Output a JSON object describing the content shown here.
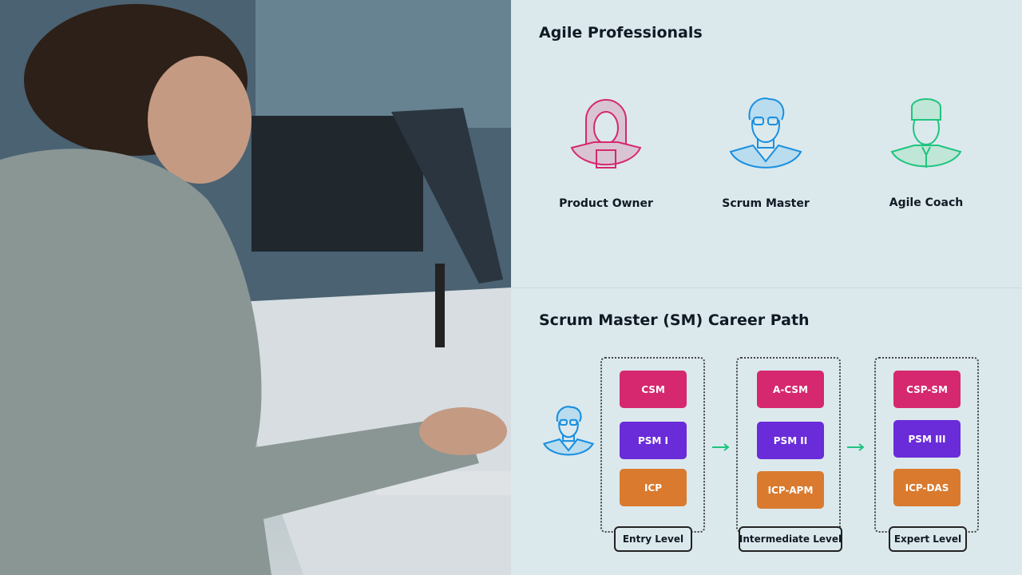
{
  "professionals": {
    "title": "Agile Professionals",
    "roles": [
      {
        "label": "Product Owner",
        "icon": "woman-avatar-icon",
        "color": "#d6286e"
      },
      {
        "label": "Scrum Master",
        "icon": "man-glasses-avatar-icon",
        "color": "#1a8fe0"
      },
      {
        "label": "Agile Coach",
        "icon": "man-cap-avatar-icon",
        "color": "#1fc47f"
      }
    ]
  },
  "career": {
    "title": "Scrum Master (SM) Career Path",
    "arrow_color": "#1fc47f",
    "levels": [
      {
        "label": "Entry Level",
        "certs": [
          "CSM",
          "PSM I",
          "ICP"
        ]
      },
      {
        "label": "Intermediate Level",
        "certs": [
          "A-CSM",
          "PSM II",
          "ICP-APM"
        ]
      },
      {
        "label": "Expert Level",
        "certs": [
          "CSP-SM",
          "PSM III",
          "ICP-DAS"
        ]
      }
    ],
    "cert_colors": [
      "#d6286e",
      "#6a2bd9",
      "#d97a2e"
    ]
  }
}
